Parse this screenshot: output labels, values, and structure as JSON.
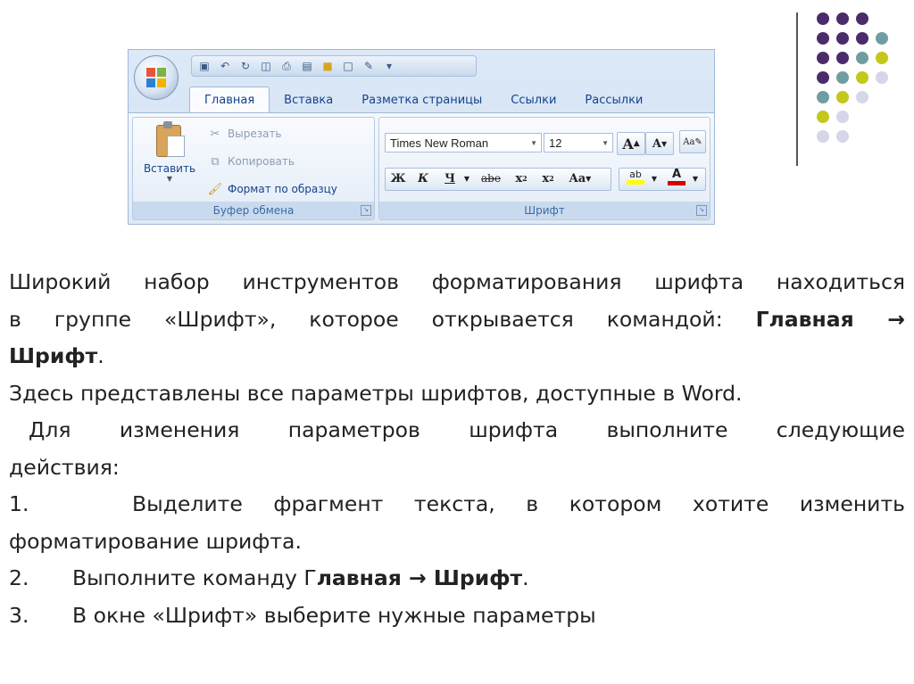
{
  "ribbon": {
    "tabs": [
      "Главная",
      "Вставка",
      "Разметка страницы",
      "Ссылки",
      "Рассылки"
    ],
    "active_tab": "Главная",
    "clipboard": {
      "paste_label": "Вставить",
      "cut_label": "Вырезать",
      "copy_label": "Копировать",
      "format_painter_label": "Формат по образцу",
      "group_title": "Буфер обмена"
    },
    "font": {
      "font_name": "Times New Roman",
      "font_size": "12",
      "grow_label": "A",
      "shrink_label": "A",
      "bold": "Ж",
      "italic": "К",
      "underline": "Ч",
      "strike": "abe",
      "subscript": "x",
      "superscript": "x",
      "change_case": "Aa",
      "highlight": "ab",
      "font_color": "A",
      "group_title": "Шрифт"
    },
    "colors": {
      "accent": "#15428b",
      "group_title": "#3e6aa6",
      "font_color_bar": "#d40000",
      "highlight_bar": "#ffff00"
    }
  },
  "body": {
    "p1_a": "Широкий набор инструментов форматирования шрифта находиться",
    "p1_b": "в группе «Шрифт», которое открывается командой:",
    "p1_b_bold": "Главная →",
    "p1_c_bold": "Шрифт",
    "p1_c_tail": ".",
    "p2": "Здесь представлены все параметры шрифтов, доступные в Word.",
    "p3_a": "Для изменения параметров шрифта выполните следующие",
    "p3_b": "действия:",
    "item1_num": "1.",
    "item1_a": "Выделите фрагмент текста, в котором хотите изменить",
    "item1_b": "форматирование шрифта.",
    "item2_num": "2.",
    "item2_text": "Выполните команду Г",
    "item2_bold": "лавная → Шрифт",
    "item2_tail": ".",
    "item3_num": "3.",
    "item3_text": "В окне «Шрифт» выберите нужные параметры"
  },
  "decoration": {
    "dot_colors": [
      "#4b2c6b",
      "#6f9ea2",
      "#c3c81b",
      "#d6d6ea"
    ]
  }
}
